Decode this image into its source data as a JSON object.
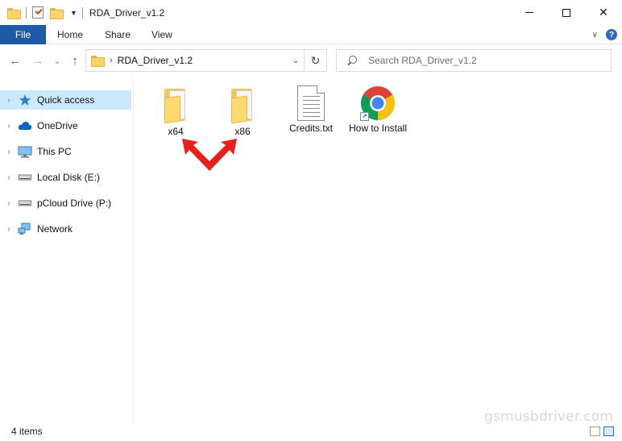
{
  "window": {
    "title": "RDA_Driver_v1.2",
    "controls": {
      "minimize": "minimize",
      "maximize": "maximize",
      "close": "✕"
    }
  },
  "ribbon": {
    "tabs": [
      {
        "label": "File"
      },
      {
        "label": "Home"
      },
      {
        "label": "Share"
      },
      {
        "label": "View"
      }
    ]
  },
  "navigation": {
    "back_icon": "←",
    "forward_icon": "→",
    "recent_icon": "⌄",
    "up_icon": "↑",
    "breadcrumb_sep": "›",
    "address_path": "RDA_Driver_v1.2",
    "dropdown_icon": "⌄",
    "refresh_icon": "↻",
    "search_placeholder": "Search RDA_Driver_v1.2"
  },
  "sidebar": {
    "items": [
      {
        "label": "Quick access",
        "icon": "star-icon",
        "selected": true
      },
      {
        "label": "OneDrive",
        "icon": "cloud-icon"
      },
      {
        "label": "This PC",
        "icon": "monitor-icon"
      },
      {
        "label": "Local Disk (E:)",
        "icon": "drive-icon"
      },
      {
        "label": "pCloud Drive (P:)",
        "icon": "drive-icon"
      },
      {
        "label": "Network",
        "icon": "network-icon"
      }
    ]
  },
  "files": [
    {
      "name": "x64",
      "type": "folder"
    },
    {
      "name": "x86",
      "type": "folder"
    },
    {
      "name": "Credits.txt",
      "type": "text-file"
    },
    {
      "name": "How to Install",
      "type": "chrome-shortcut"
    }
  ],
  "status": {
    "item_count": "4 items"
  },
  "watermark": "gsmusbdriver.com",
  "colors": {
    "file_tab": "#1e5aa8",
    "selection": "#cce8ff",
    "arrow": "#e8201a"
  }
}
